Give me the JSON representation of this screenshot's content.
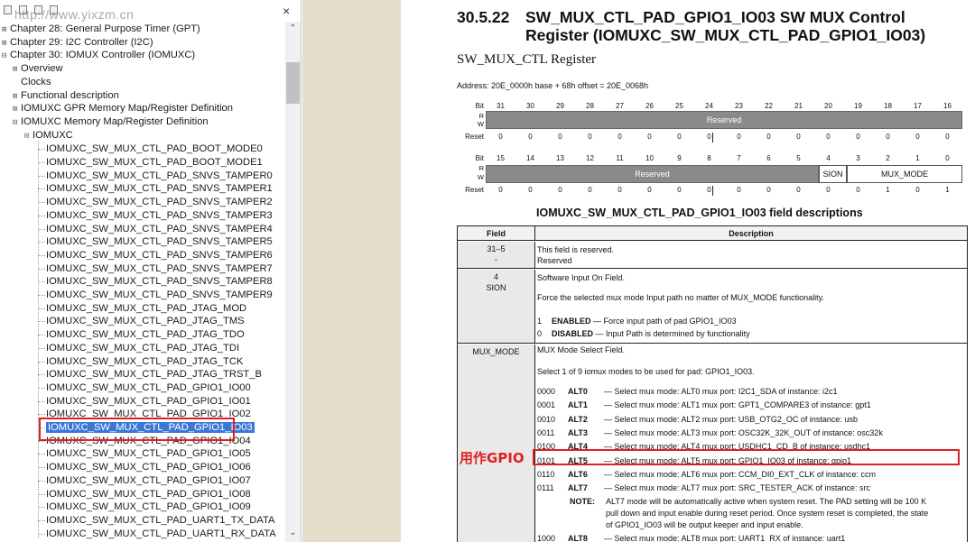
{
  "nav": {
    "watermark": "http://www.yixzm.cn",
    "close_glyph": "×",
    "scroll_up": "⌃",
    "scroll_down": "⌄",
    "tree": [
      {
        "toggle": "⊞",
        "label": "Chapter 28: General Purpose Timer (GPT)"
      },
      {
        "toggle": "⊞",
        "label": "Chapter 29: I2C Controller (I2C)"
      },
      {
        "toggle": "⊟",
        "label": "Chapter 30: IOMUX Controller (IOMUXC)"
      },
      {
        "toggle": "⊞",
        "label": "Overview"
      },
      {
        "toggle": "",
        "label": "Clocks"
      },
      {
        "toggle": "⊞",
        "label": "Functional description"
      },
      {
        "toggle": "⊞",
        "label": "IOMUXC GPR Memory Map/Register Definition"
      },
      {
        "toggle": "⊟",
        "label": "IOMUXC Memory Map/Register Definition"
      },
      {
        "toggle": "⊟",
        "label": "IOMUXC"
      }
    ],
    "registers": [
      "IOMUXC_SW_MUX_CTL_PAD_BOOT_MODE0",
      "IOMUXC_SW_MUX_CTL_PAD_BOOT_MODE1",
      "IOMUXC_SW_MUX_CTL_PAD_SNVS_TAMPER0",
      "IOMUXC_SW_MUX_CTL_PAD_SNVS_TAMPER1",
      "IOMUXC_SW_MUX_CTL_PAD_SNVS_TAMPER2",
      "IOMUXC_SW_MUX_CTL_PAD_SNVS_TAMPER3",
      "IOMUXC_SW_MUX_CTL_PAD_SNVS_TAMPER4",
      "IOMUXC_SW_MUX_CTL_PAD_SNVS_TAMPER5",
      "IOMUXC_SW_MUX_CTL_PAD_SNVS_TAMPER6",
      "IOMUXC_SW_MUX_CTL_PAD_SNVS_TAMPER7",
      "IOMUXC_SW_MUX_CTL_PAD_SNVS_TAMPER8",
      "IOMUXC_SW_MUX_CTL_PAD_SNVS_TAMPER9",
      "IOMUXC_SW_MUX_CTL_PAD_JTAG_MOD",
      "IOMUXC_SW_MUX_CTL_PAD_JTAG_TMS",
      "IOMUXC_SW_MUX_CTL_PAD_JTAG_TDO",
      "IOMUXC_SW_MUX_CTL_PAD_JTAG_TDI",
      "IOMUXC_SW_MUX_CTL_PAD_JTAG_TCK",
      "IOMUXC_SW_MUX_CTL_PAD_JTAG_TRST_B",
      "IOMUXC_SW_MUX_CTL_PAD_GPIO1_IO00",
      "IOMUXC_SW_MUX_CTL_PAD_GPIO1_IO01",
      "IOMUXC_SW_MUX_CTL_PAD_GPIO1_IO02",
      "IOMUXC_SW_MUX_CTL_PAD_GPIO1_IO03",
      "IOMUXC_SW_MUX_CTL_PAD_GPIO1_IO04",
      "IOMUXC_SW_MUX_CTL_PAD_GPIO1_IO05",
      "IOMUXC_SW_MUX_CTL_PAD_GPIO1_IO06",
      "IOMUXC_SW_MUX_CTL_PAD_GPIO1_IO07",
      "IOMUXC_SW_MUX_CTL_PAD_GPIO1_IO08",
      "IOMUXC_SW_MUX_CTL_PAD_GPIO1_IO09",
      "IOMUXC_SW_MUX_CTL_PAD_UART1_TX_DATA",
      "IOMUXC_SW_MUX_CTL_PAD_UART1_RX_DATA"
    ],
    "selected_index": 21
  },
  "doc": {
    "section_number": "30.5.22",
    "title_line1": "SW_MUX_CTL_PAD_GPIO1_IO03 SW MUX Control",
    "title_line2": "Register (IOMUXC_SW_MUX_CTL_PAD_GPIO1_IO03)",
    "register_name": "SW_MUX_CTL Register",
    "address": "Address: 20E_0000h base + 68h offset = 20E_0068h",
    "bit_label": "Bit",
    "r_label": "R",
    "w_label": "W",
    "reset_label": "Reset",
    "bits_hi": [
      "31",
      "30",
      "29",
      "28",
      "27",
      "26",
      "25",
      "24",
      "23",
      "22",
      "21",
      "20",
      "19",
      "18",
      "17",
      "16"
    ],
    "bits_lo": [
      "15",
      "14",
      "13",
      "12",
      "11",
      "10",
      "9",
      "8",
      "7",
      "6",
      "5",
      "4",
      "3",
      "2",
      "1",
      "0"
    ],
    "reset_hi": [
      "0",
      "0",
      "0",
      "0",
      "0",
      "0",
      "0",
      "0",
      "0",
      "0",
      "0",
      "0",
      "0",
      "0",
      "0",
      "0"
    ],
    "reset_lo": [
      "0",
      "0",
      "0",
      "0",
      "0",
      "0",
      "0",
      "0",
      "0",
      "0",
      "0",
      "0",
      "0",
      "1",
      "0",
      "1"
    ],
    "reserved_label": "Reserved",
    "sion_label": "SION",
    "mux_mode_label": "MUX_MODE",
    "table_title": "IOMUXC_SW_MUX_CTL_PAD_GPIO1_IO03 field descriptions",
    "col_field": "Field",
    "col_description": "Description",
    "row1": {
      "field1": "31–5",
      "field2": "-",
      "d1": "This field is reserved.",
      "d2": "Reserved"
    },
    "row2": {
      "field1": "4",
      "field2": "SION",
      "d1": "Software Input On Field.",
      "d2": "Force the selected mux mode Input path no matter of MUX_MODE functionality.",
      "e1_code": "1",
      "e1_name": "ENABLED",
      "e1_text": " — Force input path of pad GPIO1_IO03",
      "e0_code": "0",
      "e0_name": "DISABLED",
      "e0_text": " — Input Path is determined by functionality"
    },
    "row3": {
      "field1": "MUX_MODE",
      "d1": "MUX Mode Select Field.",
      "d2": "Select 1 of 9 iomux modes to be used for pad: GPIO1_IO03.",
      "options": [
        {
          "code": "0000",
          "alt": "ALT0",
          "text": "— Select mux mode: ALT0 mux port: I2C1_SDA of instance: i2c1"
        },
        {
          "code": "0001",
          "alt": "ALT1",
          "text": "— Select mux mode: ALT1 mux port: GPT1_COMPARE3 of instance: gpt1"
        },
        {
          "code": "0010",
          "alt": "ALT2",
          "text": "— Select mux mode: ALT2 mux port: USB_OTG2_OC of instance: usb"
        },
        {
          "code": "0011",
          "alt": "ALT3",
          "text": "— Select mux mode: ALT3 mux port: OSC32K_32K_OUT of instance: osc32k"
        },
        {
          "code": "0100",
          "alt": "ALT4",
          "text": "— Select mux mode: ALT4 mux port: USDHC1_CD_B of instance: usdhc1"
        },
        {
          "code": "0101",
          "alt": "ALT5",
          "text": "— Select mux mode: ALT5 mux port: GPIO1_IO03 of instance: gpio1"
        },
        {
          "code": "0110",
          "alt": "ALT6",
          "text": "— Select mux mode: ALT6 mux port: CCM_DI0_EXT_CLK of instance: ccm"
        },
        {
          "code": "0111",
          "alt": "ALT7",
          "text": "— Select mux mode: ALT7 mux port: SRC_TESTER_ACK of instance: src"
        }
      ],
      "note_label": "NOTE:",
      "note_l1": "ALT7 mode will be automatically active when system reset. The PAD setting will be 100 K",
      "note_l2": "pull down and input enable during reset period. Once system reset is completed, the state",
      "note_l3": "of GPIO1_IO03 will be output keeper and input enable.",
      "last": {
        "code": "1000",
        "alt": "ALT8",
        "text": "— Select mux mode: ALT8 mux port: UART1_RX of instance: uart1"
      }
    },
    "annotation": "用作GPIO"
  }
}
